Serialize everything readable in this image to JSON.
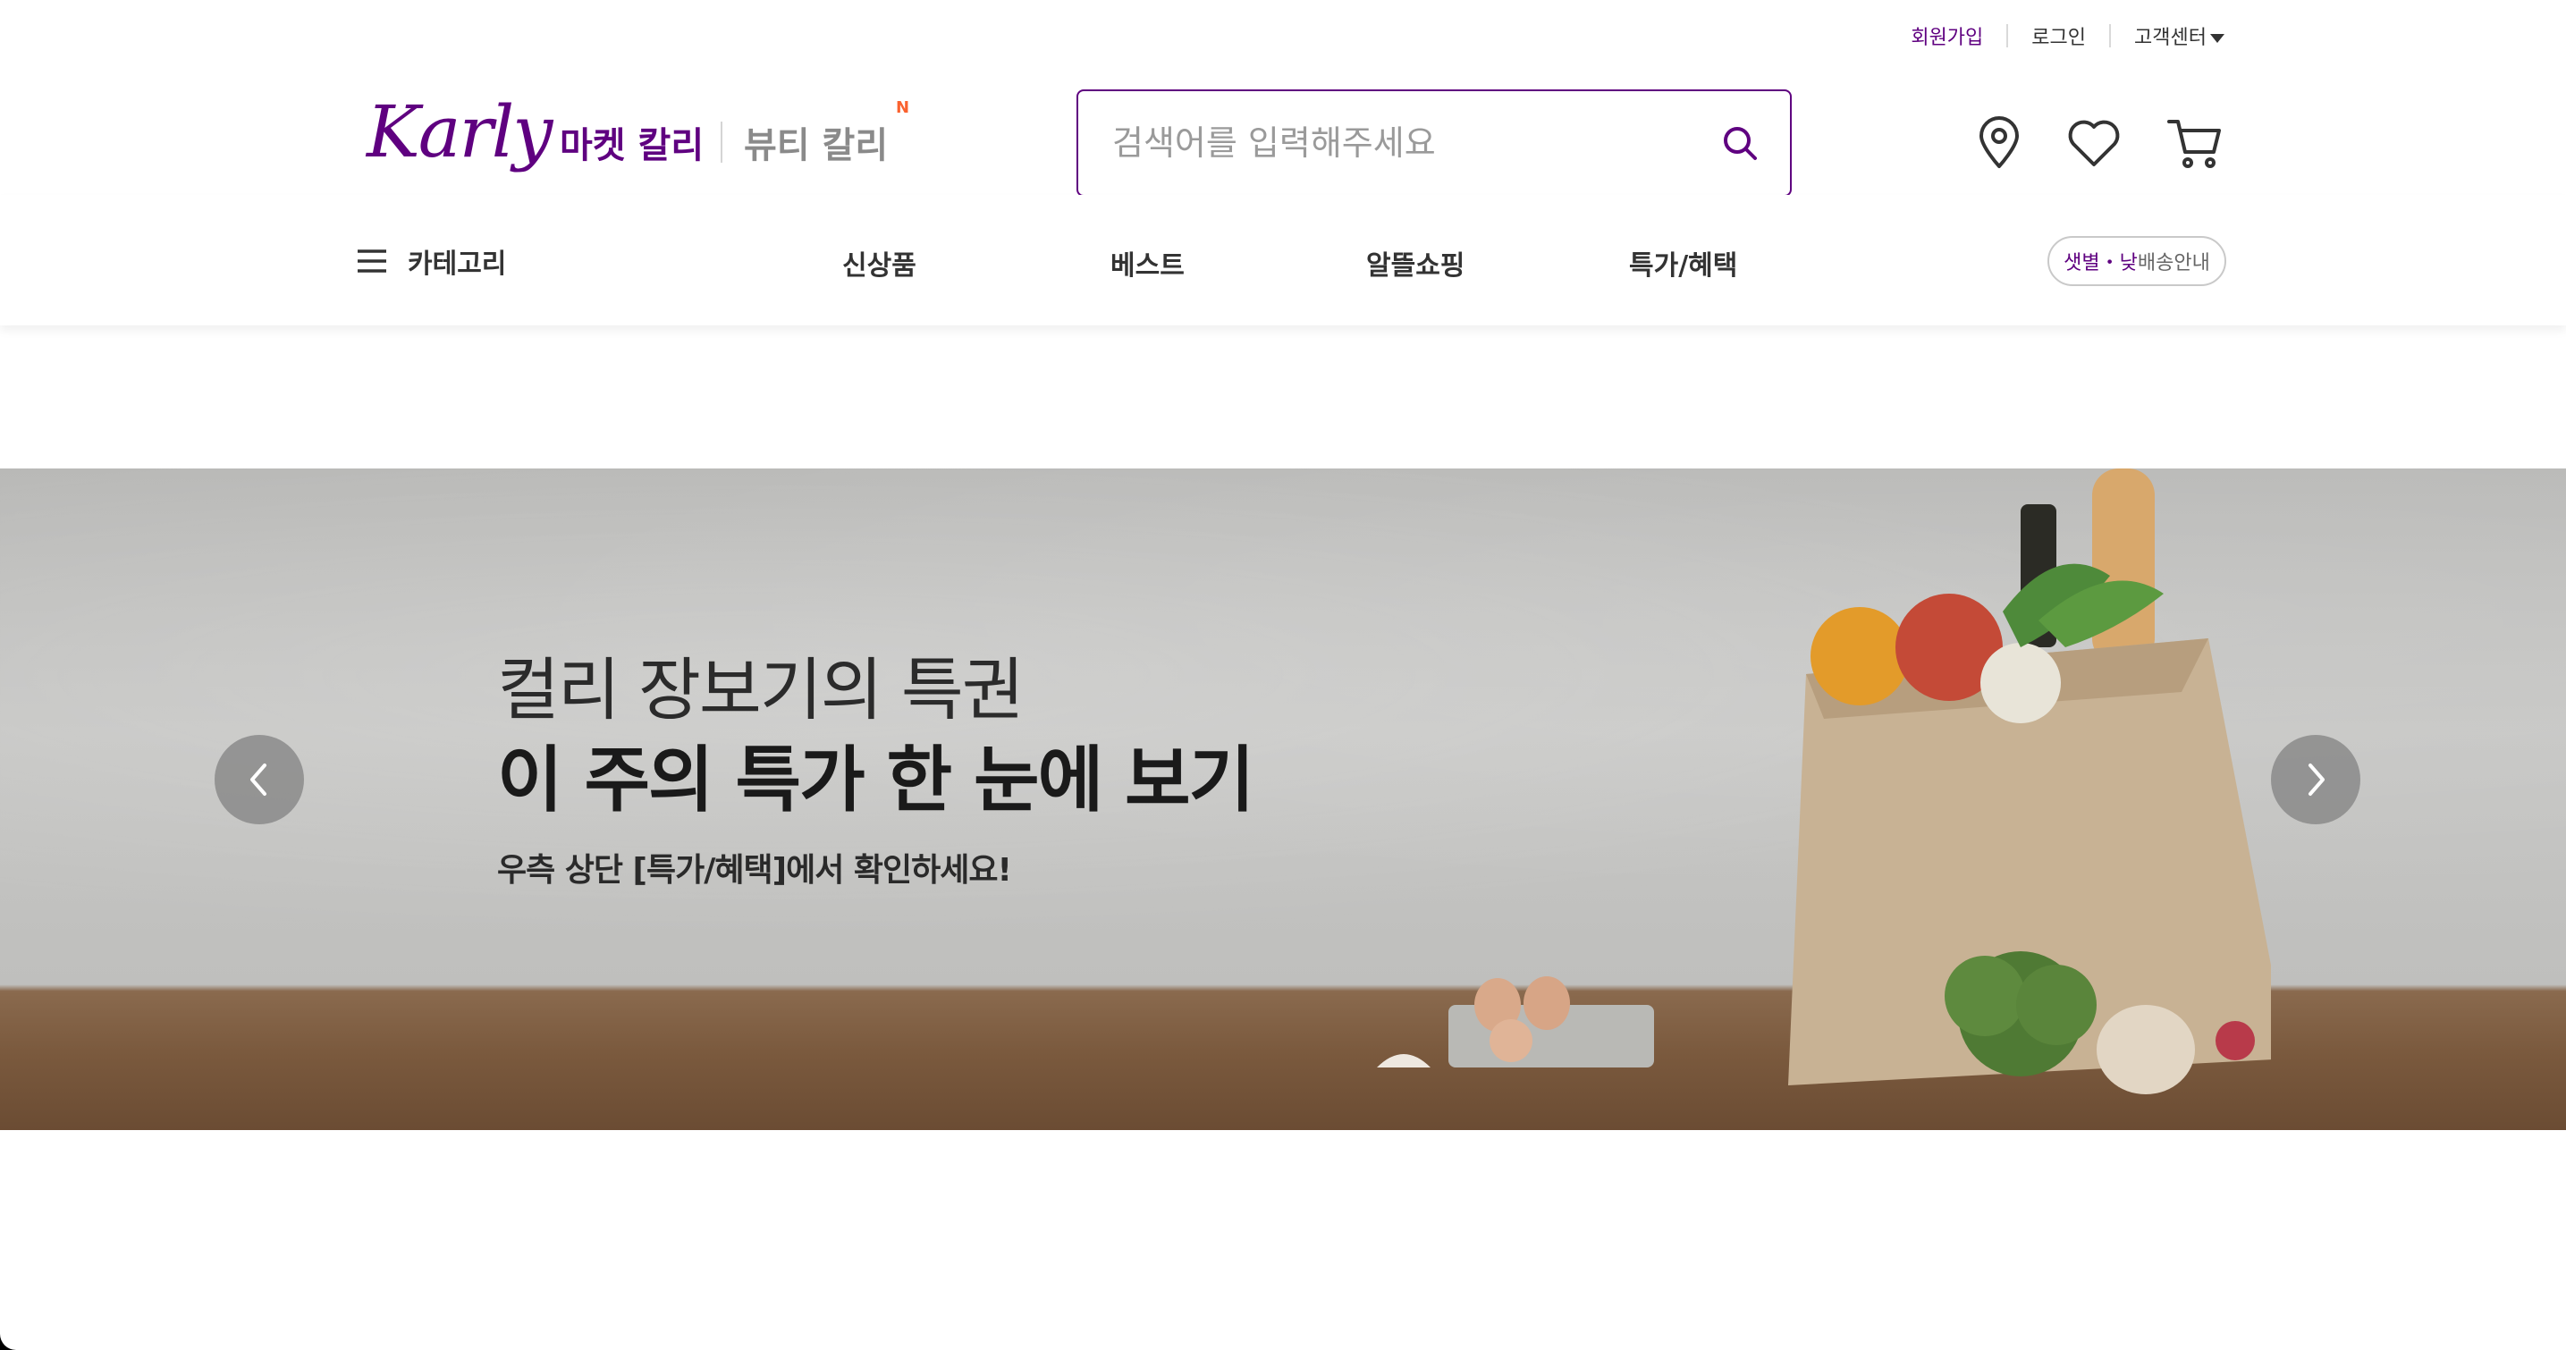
{
  "utility": {
    "signup": "회원가입",
    "login": "로그인",
    "support": "고객센터"
  },
  "brand": {
    "logo": "Karly",
    "market": "마켓 칼리",
    "beauty": "뷰티 칼리",
    "beauty_badge": "N"
  },
  "search": {
    "placeholder": "검색어를 입력해주세요"
  },
  "nav": {
    "category": "카테고리",
    "items": [
      "신상품",
      "베스트",
      "알뜰쇼핑",
      "특가/혜택"
    ],
    "delivery_highlight": "샛별・낮",
    "delivery_label": " 배송안내"
  },
  "banner": {
    "line1": "컬리 장보기의 특권",
    "line2": "이 주의 특가 한 눈에 보기",
    "line3": "우측 상단 [특가/혜택]에서 확인하세요!"
  },
  "icons": [
    "location-icon",
    "heart-icon",
    "cart-icon",
    "search-icon",
    "hamburger-icon",
    "chevron-left-icon",
    "chevron-right-icon"
  ],
  "colors": {
    "brand_purple": "#5f0080",
    "new_badge": "#fa622f"
  }
}
